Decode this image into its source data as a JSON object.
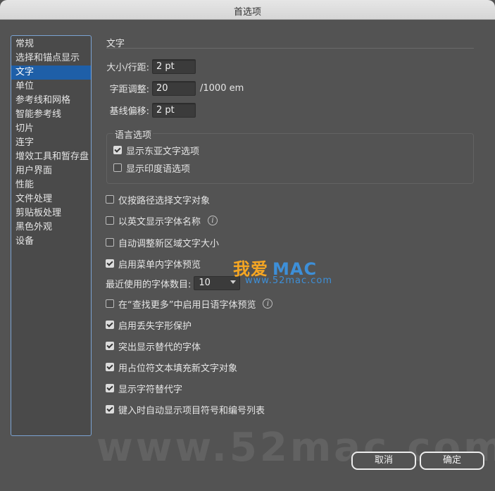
{
  "window": {
    "title": "首选项"
  },
  "sidebar": {
    "items": [
      {
        "label": "常规",
        "selected": false
      },
      {
        "label": "选择和锚点显示",
        "selected": false
      },
      {
        "label": "文字",
        "selected": true
      },
      {
        "label": "单位",
        "selected": false
      },
      {
        "label": "参考线和网格",
        "selected": false
      },
      {
        "label": "智能参考线",
        "selected": false
      },
      {
        "label": "切片",
        "selected": false
      },
      {
        "label": "连字",
        "selected": false
      },
      {
        "label": "增效工具和暂存盘",
        "selected": false
      },
      {
        "label": "用户界面",
        "selected": false
      },
      {
        "label": "性能",
        "selected": false
      },
      {
        "label": "文件处理",
        "selected": false
      },
      {
        "label": "剪贴板处理",
        "selected": false
      },
      {
        "label": "黑色外观",
        "selected": false
      },
      {
        "label": "设备",
        "selected": false
      }
    ]
  },
  "panel": {
    "title": "文字",
    "size_leading": {
      "label": "大小/行距:",
      "value": "2 pt"
    },
    "tracking": {
      "label": "字距调整:",
      "value": "20",
      "unit": "/1000 em"
    },
    "baseline_shift": {
      "label": "基线偏移:",
      "value": "2 pt"
    },
    "language": {
      "title": "语言选项",
      "show_east_asian": {
        "label": "显示东亚文字选项",
        "checked": true
      },
      "show_indic": {
        "label": "显示印度语选项",
        "checked": false
      }
    },
    "options": {
      "path_select": {
        "label": "仅按路径选择文字对象",
        "checked": false
      },
      "english_font_names": {
        "label": "以英文显示字体名称",
        "checked": false
      },
      "auto_resize": {
        "label": "自动调整新区域文字大小",
        "checked": false
      },
      "menu_preview": {
        "label": "启用菜单内字体预览",
        "checked": true
      },
      "recent_fonts": {
        "label": "最近使用的字体数目:",
        "value": "10"
      },
      "find_more_jp": {
        "label": "在“查找更多”中启用日语字体预览",
        "checked": false
      },
      "missing_glyph": {
        "label": "启用丢失字形保护",
        "checked": true
      },
      "highlight_substituted": {
        "label": "突出显示替代的字体",
        "checked": true
      },
      "fill_placeholder": {
        "label": "用占位符文本填充新文字对象",
        "checked": true
      },
      "show_alternates": {
        "label": "显示字符替代字",
        "checked": true
      },
      "auto_bullets": {
        "label": "键入时自动显示项目符号和编号列表",
        "checked": true
      }
    }
  },
  "watermark": {
    "main_cn": "我爱",
    "main_en": "MAC",
    "sub": "www.52mac.com",
    "big": "www.52mac.com"
  },
  "buttons": {
    "cancel": "取消",
    "ok": "确定"
  }
}
